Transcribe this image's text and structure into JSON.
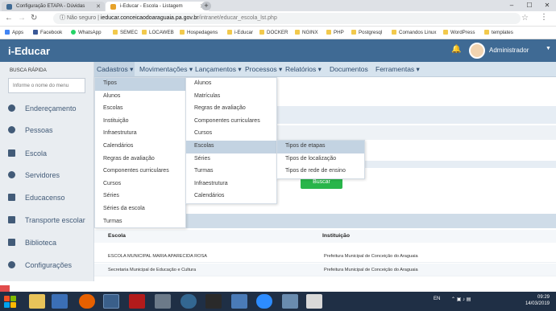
{
  "browser": {
    "tabs": [
      {
        "title": "Configuração ETAPA - Dúvidas"
      },
      {
        "title": "i-Educar - Escola - Listagem"
      }
    ],
    "new_tab": "+",
    "address": {
      "security": "Não seguro",
      "domain": "ieducar.conceicaodoaraguaia.pa.gov.br",
      "path": "/intranet/educar_escola_lst.php"
    },
    "bookmarks": [
      "Apps",
      "Facebook",
      "WhatsApp",
      "SEMEC",
      "LOCAWEB",
      "Hospedagens",
      "i-Educar",
      "DOCKER",
      "NGINX",
      "PHP",
      "Postgresql",
      "Comandos Linux",
      "WordPress",
      "templates"
    ]
  },
  "app": {
    "brand": "i-Educar",
    "user_name": "Administrador"
  },
  "sidebar": {
    "quick_search_label": "BUSCA RÁPIDA",
    "quick_search_placeholder": "Informe o nome do menu",
    "items": [
      {
        "label": "Endereçamento",
        "icon": "map-pin-icon"
      },
      {
        "label": "Pessoas",
        "icon": "person-icon"
      },
      {
        "label": "Escola",
        "icon": "school-icon"
      },
      {
        "label": "Servidores",
        "icon": "people-icon"
      },
      {
        "label": "Educacenso",
        "icon": "bar-chart-icon"
      },
      {
        "label": "Transporte escolar",
        "icon": "bus-icon"
      },
      {
        "label": "Biblioteca",
        "icon": "book-icon"
      },
      {
        "label": "Configurações",
        "icon": "gear-icon"
      }
    ]
  },
  "menu": {
    "items": [
      "Cadastros",
      "Movimentações",
      "Lançamentos",
      "Processos",
      "Relatórios",
      "Documentos",
      "Ferramentas"
    ]
  },
  "dropdown_cadastros": [
    "Tipos",
    "Alunos",
    "Escolas",
    "Instituição",
    "Infraestrutura",
    "Calendários",
    "Regras de avaliação",
    "Componentes curriculares",
    "Cursos",
    "Séries",
    "Séries da escola",
    "Turmas"
  ],
  "dropdown_tipos": [
    "Alunos",
    "Matrículas",
    "Regras de avaliação",
    "Componentes curriculares",
    "Cursos",
    "Escolas",
    "Séries",
    "Turmas",
    "Infraestrutura",
    "Calendários"
  ],
  "dropdown_escolas": [
    "Tipos de etapas",
    "Tipos de localização",
    "Tipos de rede de ensino"
  ],
  "content": {
    "search_button": "Buscar",
    "table": {
      "headers": [
        "Escola",
        "Instituição"
      ],
      "rows": [
        [
          "ESCOLA MUNICIPAL MARIA APARECIDA ROSA",
          "Prefeitura Municipal de Conceição do Araguaia"
        ],
        [
          "Secretaria Municipal de Educação e Cultura",
          "Prefeitura Municipal de Conceição do Araguaia"
        ]
      ]
    }
  },
  "taskbar": {
    "language": "EN",
    "time": "09:29",
    "date": "14/03/2019"
  },
  "colors": {
    "topbar": "#3f6a94",
    "menubar": "#d6e3ee",
    "sidebar": "#e9edf1",
    "accent_green": "#29b54a",
    "selected": "#c3d3e2"
  }
}
